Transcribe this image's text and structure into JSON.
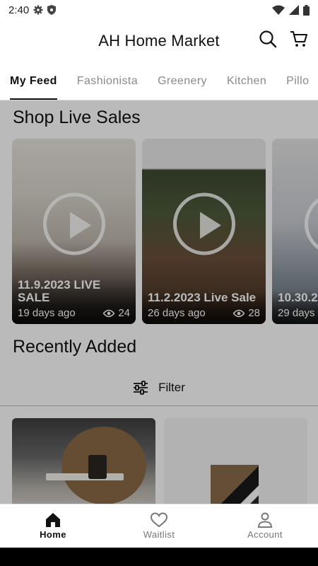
{
  "status": {
    "time": "2:40"
  },
  "app": {
    "title": "AH Home Market"
  },
  "tabs": [
    {
      "label": "My Feed",
      "active": true
    },
    {
      "label": "Fashionista",
      "active": false
    },
    {
      "label": "Greenery",
      "active": false
    },
    {
      "label": "Kitchen",
      "active": false
    },
    {
      "label": "Pillo",
      "active": false
    }
  ],
  "live": {
    "title": "Shop Live Sales",
    "cards": [
      {
        "title": "11.9.2023 LIVE SALE",
        "age": "19 days ago",
        "views": "24"
      },
      {
        "title": "11.2.2023 Live Sale",
        "age": "26 days ago",
        "views": "28"
      },
      {
        "title": "10.30.2",
        "age": "29 days",
        "views": ""
      }
    ]
  },
  "recent": {
    "title": "Recently Added",
    "filter_label": "Filter"
  },
  "bottom_nav": [
    {
      "label": "Home",
      "icon": "home-icon",
      "active": true
    },
    {
      "label": "Waitlist",
      "icon": "heart-icon",
      "active": false
    },
    {
      "label": "Account",
      "icon": "person-icon",
      "active": false
    }
  ],
  "colors": {
    "accent": "#111111",
    "tab_inactive": "#8a8a8a",
    "overlay": "#00000045"
  }
}
